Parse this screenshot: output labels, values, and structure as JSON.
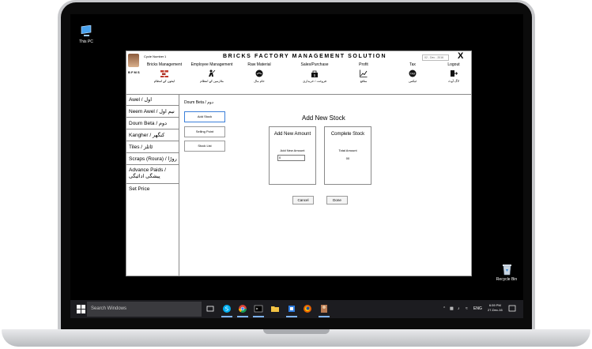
{
  "desktop": {
    "this_pc_label": "This PC",
    "recycle_bin_label": "Recycle Bin"
  },
  "app": {
    "cycle_number_label": "Cycle Number",
    "cycle_number_value": "1",
    "bfms_label": "B F M S",
    "title": "BRICKS FACTORY MANAGEMENT SOLUTION",
    "date": "02 - Dec - 2016",
    "close_label": "X",
    "menu": [
      {
        "en": "Bricks Management",
        "ur": "اینٹوں کے انتظام",
        "icon": "bricks-icon"
      },
      {
        "en": "Employee Management",
        "ur": "ملازمین کے انتظام",
        "icon": "worker-icon"
      },
      {
        "en": "Raw Material",
        "ur": "خام مال",
        "icon": "coal-icon"
      },
      {
        "en": "Sales/Purchase",
        "ur": "فروخت / خریداری",
        "icon": "cart-icon"
      },
      {
        "en": "Profit",
        "ur": "منافع",
        "icon": "chart-up-icon"
      },
      {
        "en": "Tax",
        "ur": "ٹیکس",
        "icon": "tax-icon"
      },
      {
        "en": "Logout",
        "ur": "لاگ آوٹ",
        "icon": "logout-icon"
      }
    ],
    "sidebar": [
      {
        "label": "Awel / اول"
      },
      {
        "label": "Neem Awel / نیم اول"
      },
      {
        "label": "Doum Beta / دوم"
      },
      {
        "label": "Kangher / کنگھر"
      },
      {
        "label": "Tiles / ٹائلز"
      },
      {
        "label": "Scraps (Roura) / روڑا"
      },
      {
        "label": "Advance Paids / پیشگی ادائیگی"
      },
      {
        "label": "Set Price"
      }
    ],
    "subpanel": {
      "title": "Doum Beta / دوم",
      "buttons": [
        "Add Stock",
        "Selling Point",
        "Stock List"
      ]
    },
    "content": {
      "title": "Add New Stock",
      "new_amount": {
        "title": "Add New Amount",
        "label": "Add New Amount",
        "value": "0"
      },
      "complete_stock": {
        "title": "Complete Stock",
        "label": "Total Amount",
        "value": "00"
      },
      "cancel_label": "Cancel",
      "done_label": "Done"
    }
  },
  "taskbar": {
    "search_placeholder": "Search Windows",
    "lang": "ENG",
    "time": "6:59 PM",
    "date": "27-Dec-16"
  }
}
